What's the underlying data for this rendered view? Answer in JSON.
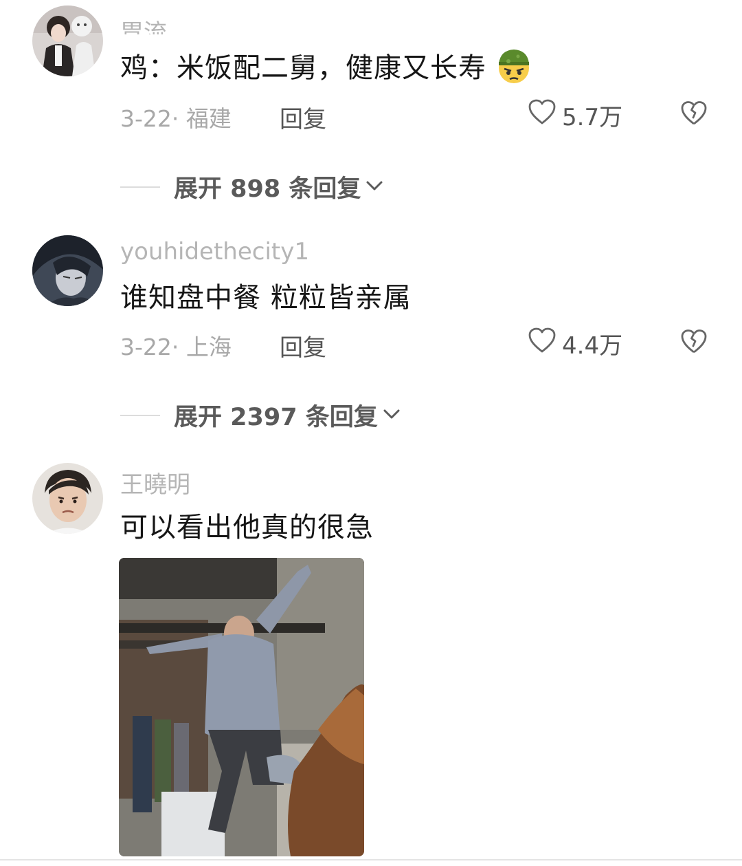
{
  "comments": [
    {
      "username": "胃流",
      "text": "鸡：米饭配二舅，健康又长寿",
      "emoji": "soldier-face-emoji",
      "date_location": "3-22· 福建",
      "reply_label": "回复",
      "likes": "5.7万",
      "expand_label": "展开 898 条回复"
    },
    {
      "username": "youhidethecity1",
      "text": "谁知盘中餐 粒粒皆亲属",
      "date_location": "3-22· 上海",
      "reply_label": "回复",
      "likes": "4.4万",
      "expand_label": "展开 2397 条回复"
    },
    {
      "username": "王曉明",
      "text": "可以看出他真的很急",
      "has_image": true
    }
  ],
  "icons": {
    "like": "heart-outline-icon",
    "dislike": "broken-heart-icon",
    "expand": "chevron-down-icon"
  },
  "colors": {
    "text_primary": "#161616",
    "text_secondary": "#a8a8a8",
    "action_text": "#555555"
  }
}
